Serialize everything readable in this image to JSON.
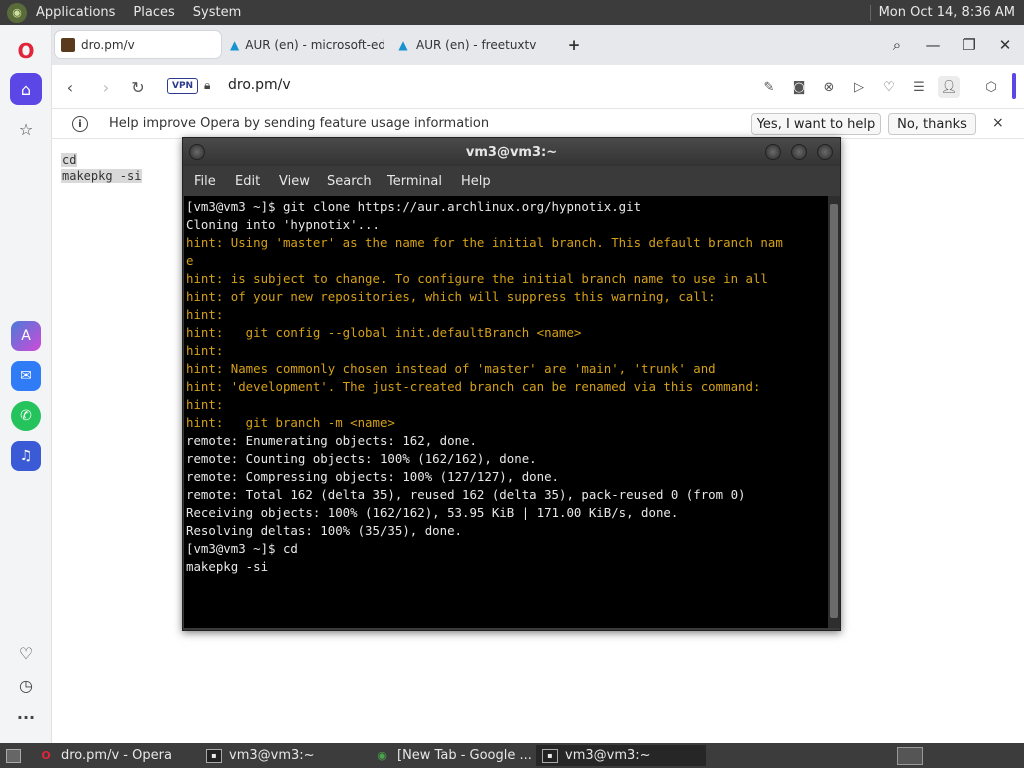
{
  "top_panel": {
    "menus": [
      "Applications",
      "Places",
      "System"
    ],
    "clock": "Mon Oct 14,  8:36 AM"
  },
  "browser": {
    "tabs": [
      {
        "title": "dro.pm/v",
        "icon": "page-favicon"
      },
      {
        "title": "AUR (en) - microsoft-ed",
        "icon": "arch-logo"
      },
      {
        "title": "AUR (en) - freetuxtv",
        "icon": "arch-logo"
      }
    ],
    "address": {
      "vpn_label": "VPN",
      "url": "dro.pm/v"
    },
    "infobar": {
      "message": "Help improve Opera by sending feature usage information",
      "accept_label": "Yes, I want to help",
      "decline_label": "No, thanks",
      "close_glyph": "×"
    },
    "page_text": [
      "cd",
      "makepkg -si"
    ]
  },
  "terminal": {
    "title": "vm3@vm3:~",
    "menu": [
      "File",
      "Edit",
      "View",
      "Search",
      "Terminal",
      "Help"
    ],
    "lines": [
      {
        "text": "[vm3@vm3 ~]$ git clone https://aur.archlinux.org/hypnotix.git",
        "kind": "normal"
      },
      {
        "text": "Cloning into 'hypnotix'...",
        "kind": "normal"
      },
      {
        "text": "hint: Using 'master' as the name for the initial branch. This default branch nam",
        "kind": "hint"
      },
      {
        "text": "e",
        "kind": "hint"
      },
      {
        "text": "hint: is subject to change. To configure the initial branch name to use in all",
        "kind": "hint"
      },
      {
        "text": "hint: of your new repositories, which will suppress this warning, call:",
        "kind": "hint"
      },
      {
        "text": "hint:",
        "kind": "hint"
      },
      {
        "text": "hint:   git config --global init.defaultBranch <name>",
        "kind": "hint"
      },
      {
        "text": "hint:",
        "kind": "hint"
      },
      {
        "text": "hint: Names commonly chosen instead of 'master' are 'main', 'trunk' and",
        "kind": "hint"
      },
      {
        "text": "hint: 'development'. The just-created branch can be renamed via this command:",
        "kind": "hint"
      },
      {
        "text": "hint:",
        "kind": "hint"
      },
      {
        "text": "hint:   git branch -m <name>",
        "kind": "hint"
      },
      {
        "text": "remote: Enumerating objects: 162, done.",
        "kind": "normal"
      },
      {
        "text": "remote: Counting objects: 100% (162/162), done.",
        "kind": "normal"
      },
      {
        "text": "remote: Compressing objects: 100% (127/127), done.",
        "kind": "normal"
      },
      {
        "text": "remote: Total 162 (delta 35), reused 162 (delta 35), pack-reused 0 (from 0)",
        "kind": "normal"
      },
      {
        "text": "Receiving objects: 100% (162/162), 53.95 KiB | 171.00 KiB/s, done.",
        "kind": "normal"
      },
      {
        "text": "Resolving deltas: 100% (35/35), done.",
        "kind": "normal"
      },
      {
        "text": "[vm3@vm3 ~]$ cd",
        "kind": "normal"
      },
      {
        "text": "makepkg -si",
        "kind": "normal"
      }
    ],
    "colors": {
      "normal": "#e8e8e8",
      "hint": "#d4a017",
      "background": "#000000"
    }
  },
  "taskbar": {
    "tasks": [
      {
        "label": "dro.pm/v - Opera",
        "icon": "opera-icon"
      },
      {
        "label": "vm3@vm3:~",
        "icon": "terminal-icon"
      },
      {
        "label": "[New Tab - Google ...",
        "icon": "chrome-icon"
      },
      {
        "label": "vm3@vm3:~",
        "icon": "terminal-icon"
      }
    ]
  }
}
